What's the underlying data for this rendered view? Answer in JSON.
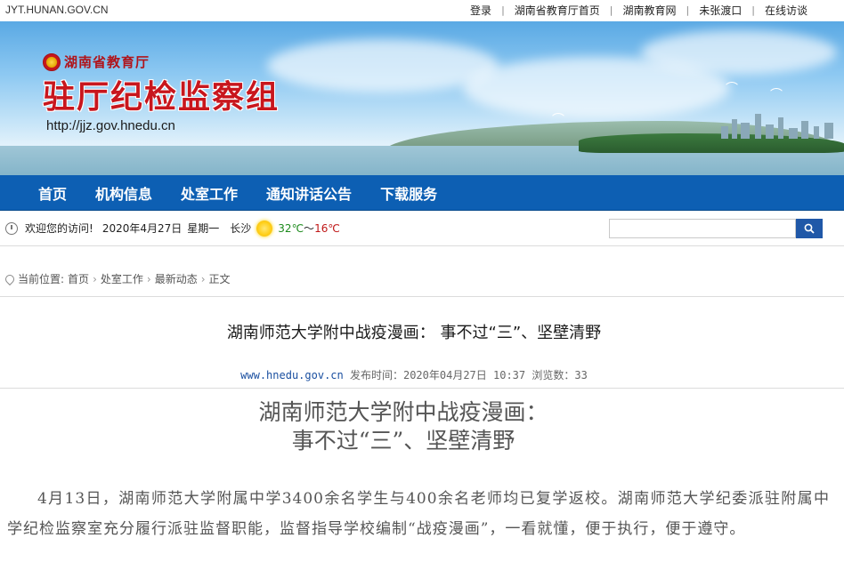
{
  "topbar": {
    "site": "JYT.HUNAN.GOV.CN",
    "links": [
      "登录",
      "湖南省教育厅首页",
      "湖南教育网",
      "未张渡口",
      "在线访谈"
    ]
  },
  "banner": {
    "org": "湖南省教育厅",
    "title": "驻厅纪检监察组",
    "url": "http://jjz.gov.hnedu.cn"
  },
  "nav": [
    "首页",
    "机构信息",
    "处室工作",
    "通知讲话公告",
    "下载服务"
  ],
  "welcome": {
    "text": "欢迎您的访问!",
    "date": "2020年4月27日",
    "weekday": "星期一",
    "city": "长沙",
    "temp_high": "32℃",
    "tilde": "～",
    "temp_low": "16℃",
    "search_placeholder": ""
  },
  "breadcrumb": {
    "label": "当前位置:",
    "items": [
      "首页",
      "处室工作",
      "最新动态",
      "正文"
    ]
  },
  "article": {
    "title": "湖南师范大学附中战疫漫画： 事不过“三”、坚壁清野",
    "source": "www.hnedu.gov.cn",
    "published": "发布时间：2020年04月27日 10:37",
    "views": "浏览数：33",
    "headline_line1": "湖南师范大学附中战疫漫画：",
    "headline_line2": "事不过“三”、坚壁清野",
    "paragraph": "4月13日，湖南师范大学附属中学3400余名学生与400余名老师均已复学返校。湖南师范大学纪委派驻附属中学纪检监察室充分履行派驻监督职能，监督指导学校编制“战疫漫画”，一看就懂，便于执行，便于遵守。"
  },
  "colors": {
    "nav": "#0d5fb3",
    "title_red": "#c8161d",
    "search_button": "#2058a8"
  }
}
